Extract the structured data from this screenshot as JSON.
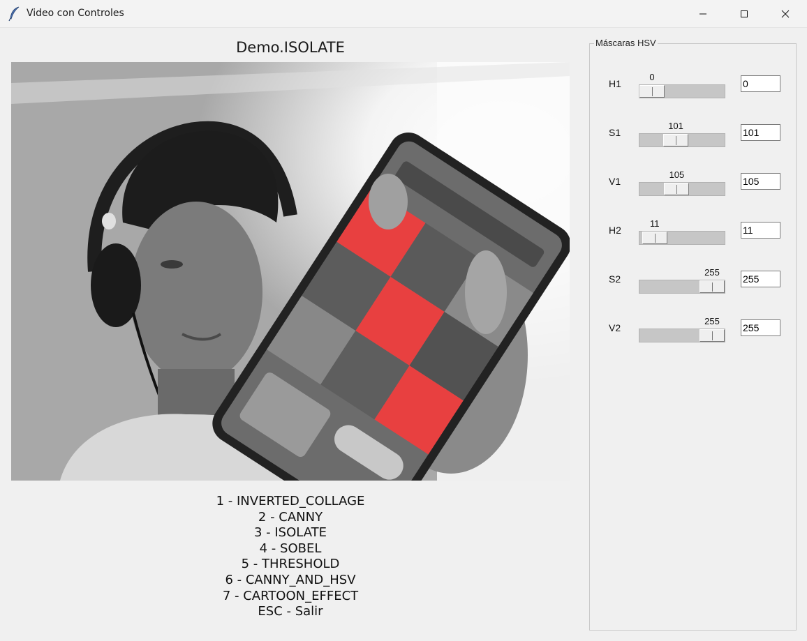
{
  "window": {
    "title": "Video con Controles",
    "icon": "feather-icon"
  },
  "video": {
    "title": "Demo.ISOLATE"
  },
  "modes": [
    "1 - INVERTED_COLLAGE",
    "2 - CANNY",
    "3 - ISOLATE",
    "4 - SOBEL",
    "5 - THRESHOLD",
    "6 - CANNY_AND_HSV",
    "7 - CARTOON_EFFECT",
    "ESC - Salir"
  ],
  "hsv": {
    "legend": "Máscaras HSV",
    "controls": [
      {
        "label": "H1",
        "value": "0",
        "entry": "0",
        "fraction": 0.0
      },
      {
        "label": "S1",
        "value": "101",
        "entry": "101",
        "fraction": 0.396
      },
      {
        "label": "V1",
        "value": "105",
        "entry": "105",
        "fraction": 0.412
      },
      {
        "label": "H2",
        "value": "11",
        "entry": "11",
        "fraction": 0.043
      },
      {
        "label": "S2",
        "value": "255",
        "entry": "255",
        "fraction": 1.0
      },
      {
        "label": "V2",
        "value": "255",
        "entry": "255",
        "fraction": 1.0
      }
    ]
  },
  "colors": {
    "background": "#f0f0f0",
    "isolated_red": "#e84040"
  }
}
